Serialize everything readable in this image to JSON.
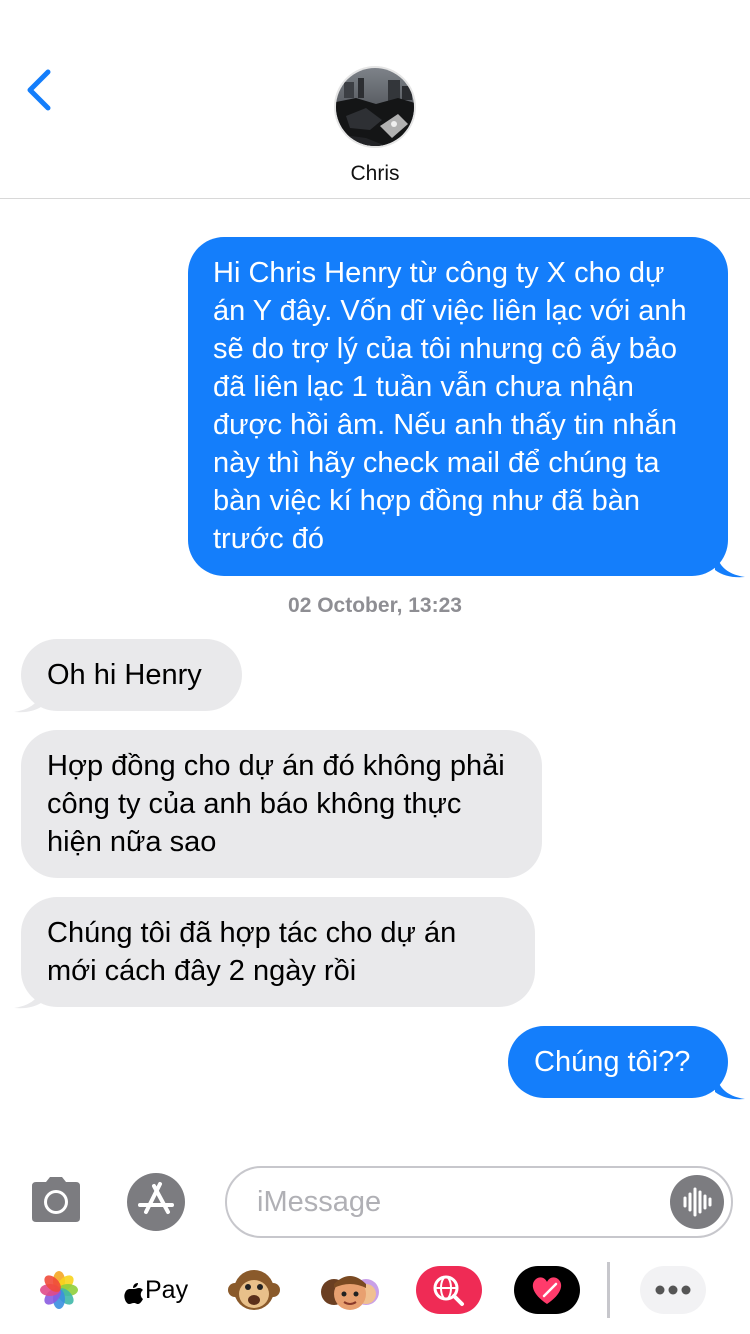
{
  "header": {
    "contact_name": "Chris"
  },
  "messages": [
    {
      "direction": "outgoing",
      "text": "Hi Chris  Henry từ công ty X cho dự án Y đây. Vốn dĩ việc liên lạc với anh sẽ do trợ lý của tôi nhưng cô ấy bảo đã liên lạc 1 tuần vẫn chưa nhận được hồi âm.  Nếu anh thấy tin nhắn này thì hãy check mail để chúng ta bàn việc kí hợp đồng như đã bàn trước đó"
    },
    {
      "direction": "incoming",
      "text": "Oh hi Henry"
    },
    {
      "direction": "incoming",
      "text": "Hợp đồng cho dự án đó không phải công ty của anh báo không thực hiện nữa sao"
    },
    {
      "direction": "incoming",
      "text": "Chúng tôi đã hợp tác cho dự án mới cách đây 2 ngày rồi"
    },
    {
      "direction": "outgoing",
      "text": "Chúng tôi??"
    }
  ],
  "timestamp": "02 October, 13:23",
  "composer": {
    "placeholder": "iMessage",
    "value": ""
  },
  "app_drawer": {
    "apple_pay_label": "Pay",
    "items": [
      "photos-icon",
      "apple-pay-icon",
      "animoji-icon",
      "memoji-stickers-icon",
      "images-search-icon",
      "digital-touch-icon",
      "more-icon"
    ]
  },
  "colors": {
    "accent": "#147efb",
    "incoming_bubble": "#e9e9eb",
    "battery": "#ffcc00"
  }
}
